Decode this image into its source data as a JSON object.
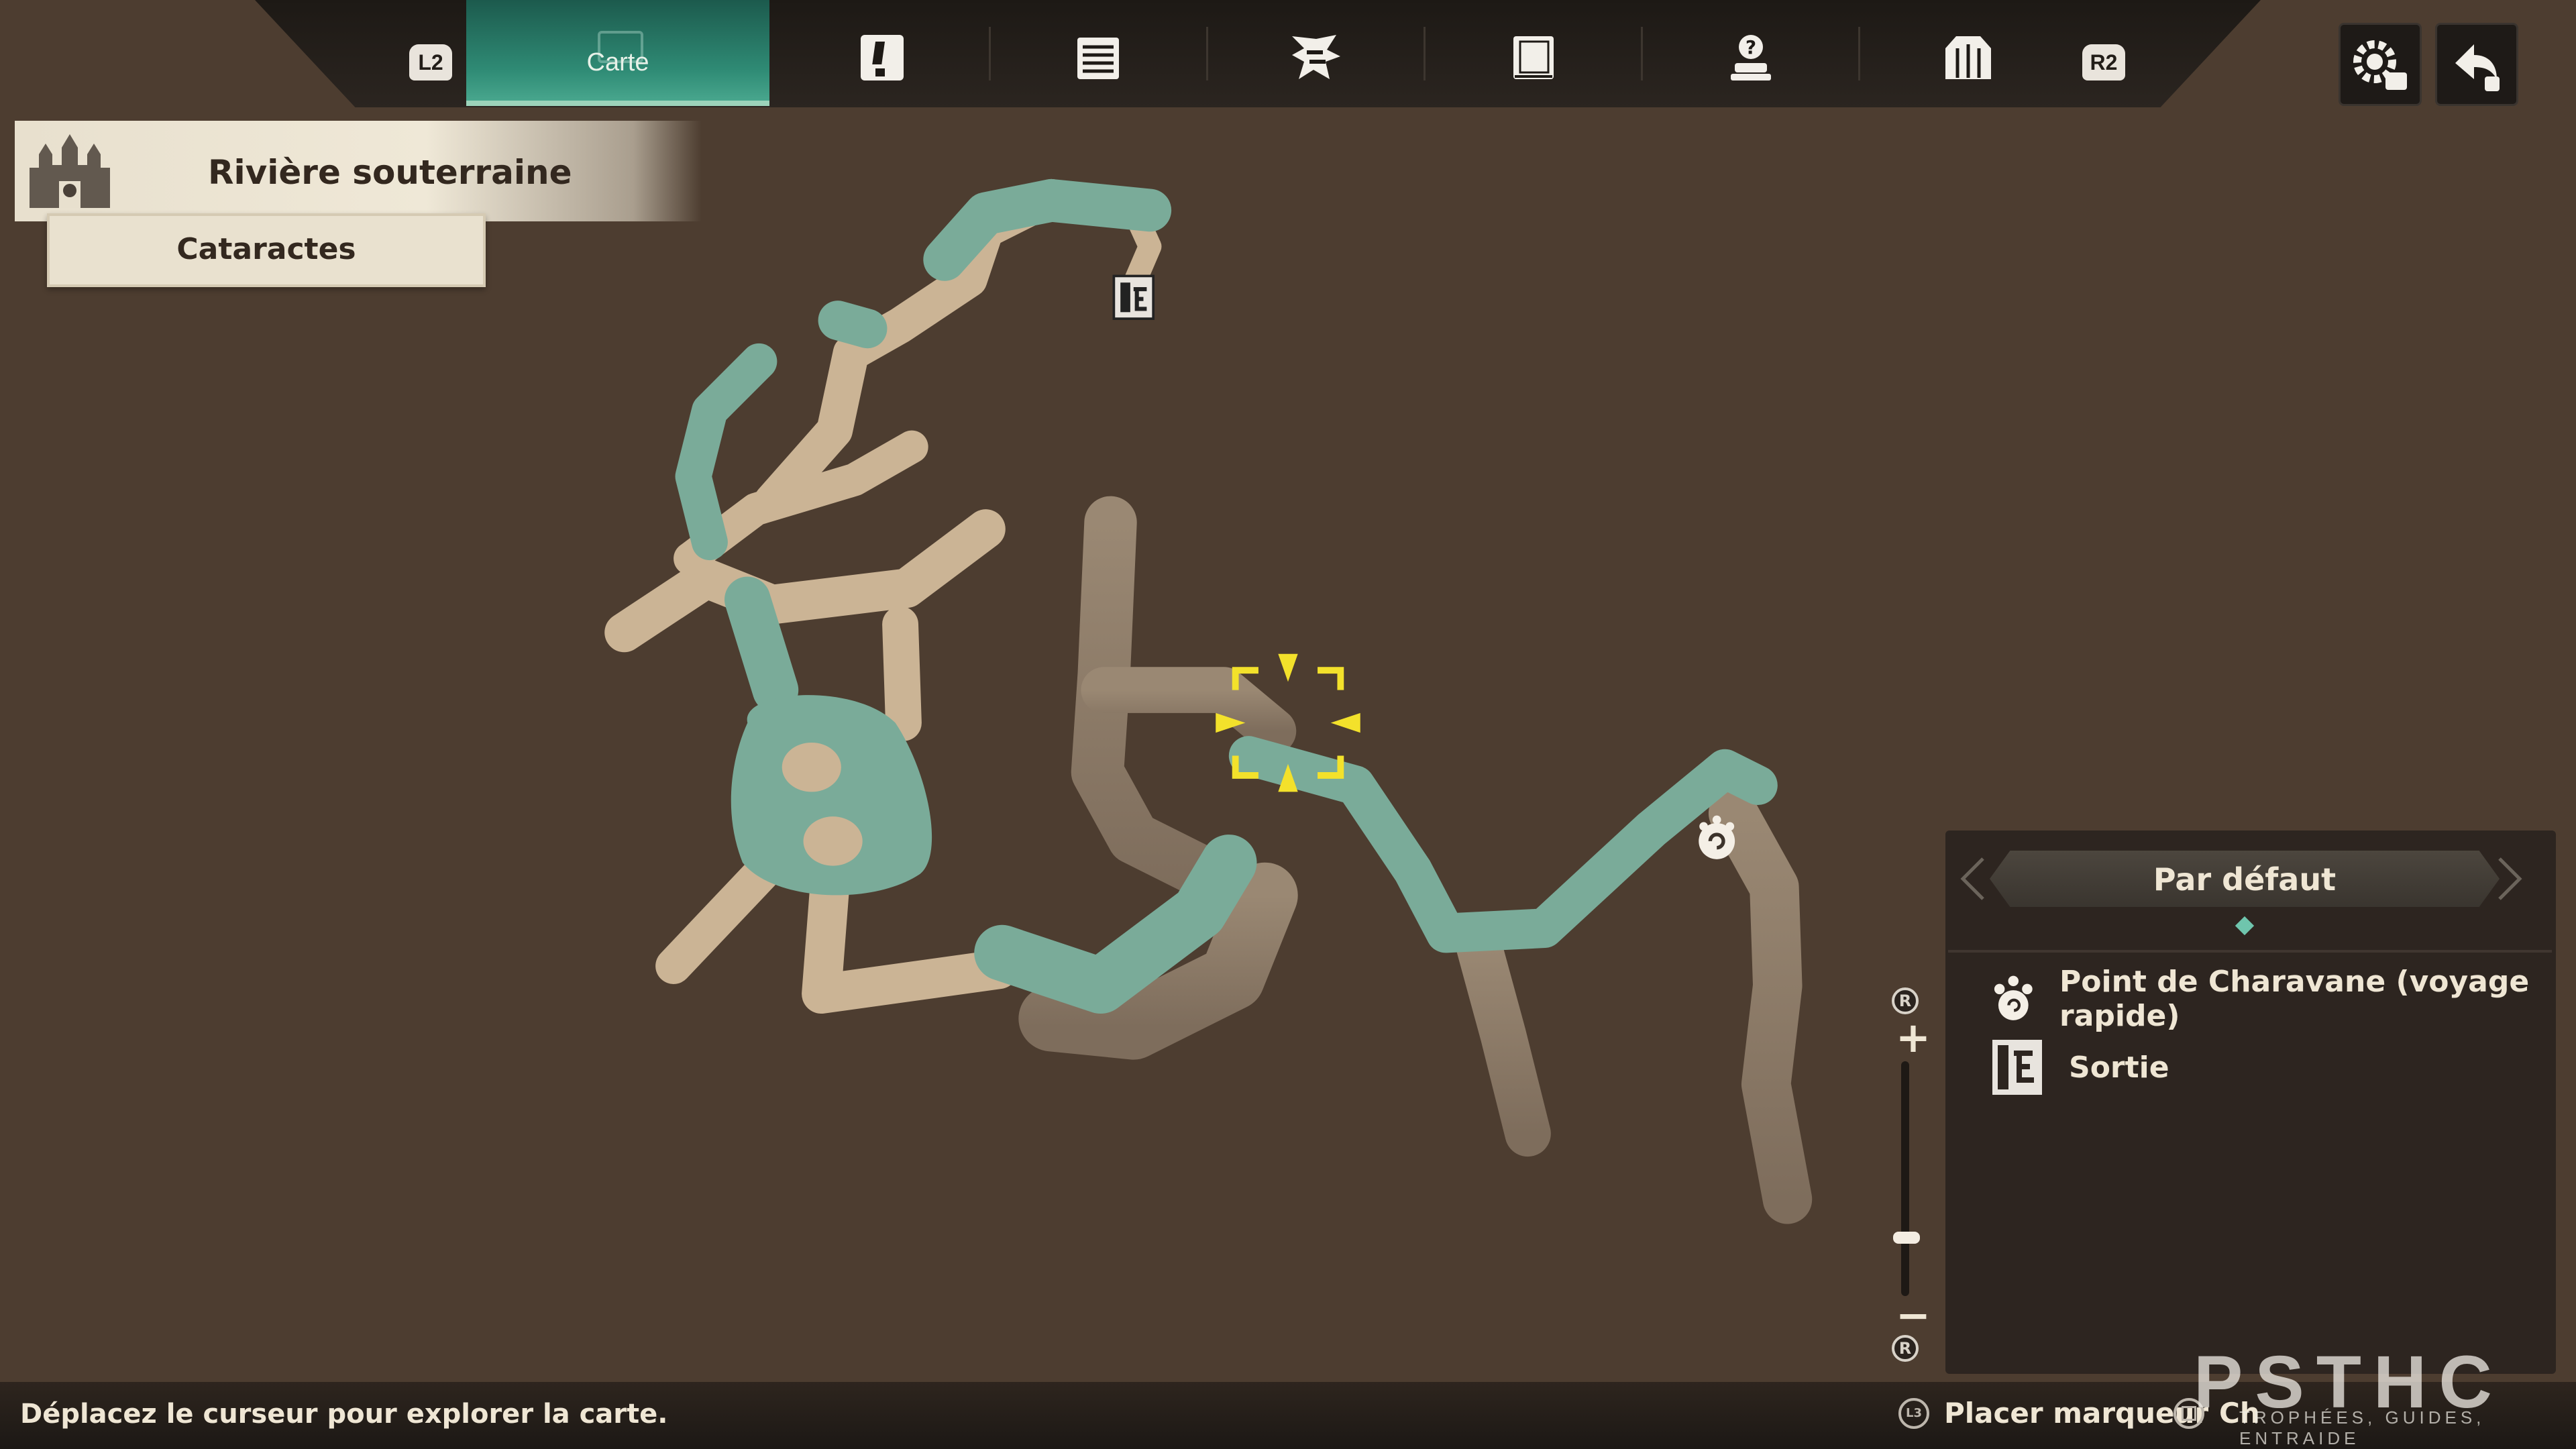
{
  "tabs": {
    "left_shoulder": "L2",
    "right_shoulder": "R2",
    "active_label": "Carte",
    "icons": [
      "quest-icon",
      "notebook-icon",
      "monster-field-guide-icon",
      "journal-icon",
      "hint-icon",
      "equipment-icon"
    ]
  },
  "corner_buttons": [
    "settings-icon",
    "return-icon"
  ],
  "region": {
    "name": "Rivière souterraine",
    "area": "Cataractes"
  },
  "legend": {
    "filter": "Par défaut",
    "items": [
      {
        "icon": "charavane-icon",
        "label": "Point de Charavane (voyage rapide)"
      },
      {
        "icon": "exit-icon",
        "label": "Sortie"
      }
    ]
  },
  "zoom": {
    "button": "R",
    "plus": "+",
    "minus": "−",
    "level": 0.25
  },
  "bottom": {
    "hint": "Déplacez le curseur pour explorer la carte.",
    "place_marker_button": "L3",
    "place_marker": "Placer marqueur",
    "second_action_partial": "Ch"
  },
  "watermark": {
    "logo": "PSTHC",
    "tagline": "TROPHÉES, GUIDES, ENTRAIDE"
  }
}
